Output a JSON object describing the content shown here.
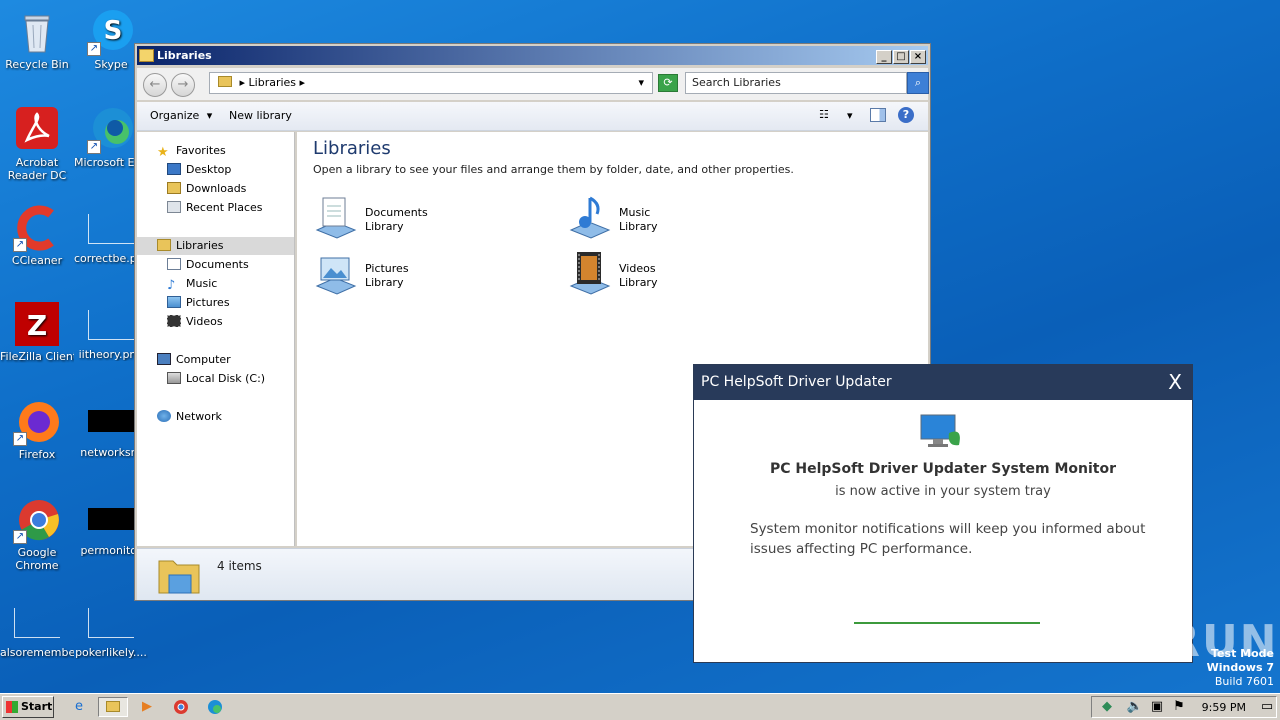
{
  "desktop": {
    "icons": [
      {
        "label": "Recycle Bin"
      },
      {
        "label": "Skype"
      },
      {
        "label": "Acrobat Reader DC"
      },
      {
        "label": "Microsoft Edge"
      },
      {
        "label": "CCleaner"
      },
      {
        "label": "correctbe.png"
      },
      {
        "label": "FileZilla Client"
      },
      {
        "label": "iitheory.png"
      },
      {
        "label": "Firefox"
      },
      {
        "label": "networksre"
      },
      {
        "label": "Google Chrome"
      },
      {
        "label": "permonitor"
      },
      {
        "label": "alsoremembe..."
      },
      {
        "label": "pokerlikely...."
      }
    ]
  },
  "explorer": {
    "title": "Libraries",
    "address": "Libraries",
    "search_placeholder": "Search Libraries",
    "toolbar": {
      "organize": "Organize",
      "new_library": "New library"
    },
    "nav": {
      "favorites": "Favorites",
      "desktop": "Desktop",
      "downloads": "Downloads",
      "recent": "Recent Places",
      "libraries": "Libraries",
      "documents": "Documents",
      "music": "Music",
      "pictures": "Pictures",
      "videos": "Videos",
      "computer": "Computer",
      "local_disk": "Local Disk (C:)",
      "network": "Network"
    },
    "content": {
      "heading": "Libraries",
      "subtext": "Open a library to see your files and arrange them by folder, date, and other properties.",
      "libraries": [
        {
          "name": "Documents",
          "type": "Library"
        },
        {
          "name": "Music",
          "type": "Library"
        },
        {
          "name": "Pictures",
          "type": "Library"
        },
        {
          "name": "Videos",
          "type": "Library"
        }
      ]
    },
    "status": "4 items"
  },
  "popup": {
    "title": "PC HelpSoft Driver Updater",
    "close": "X",
    "headline": "PC HelpSoft Driver Updater System Monitor",
    "subline": "is now active in your system tray",
    "body": "System monitor notifications will keep you informed about issues affecting PC performance."
  },
  "watermark": "ANY RUN",
  "testmode": {
    "line1": "Test Mode",
    "line2": "Windows 7",
    "line3": "Build 7601"
  },
  "taskbar": {
    "start": "Start",
    "clock": "9:59 PM"
  },
  "colors": {
    "popup_header": "#283a5a",
    "progress": "#3c9a3c",
    "titlebar": "#0a246a"
  }
}
